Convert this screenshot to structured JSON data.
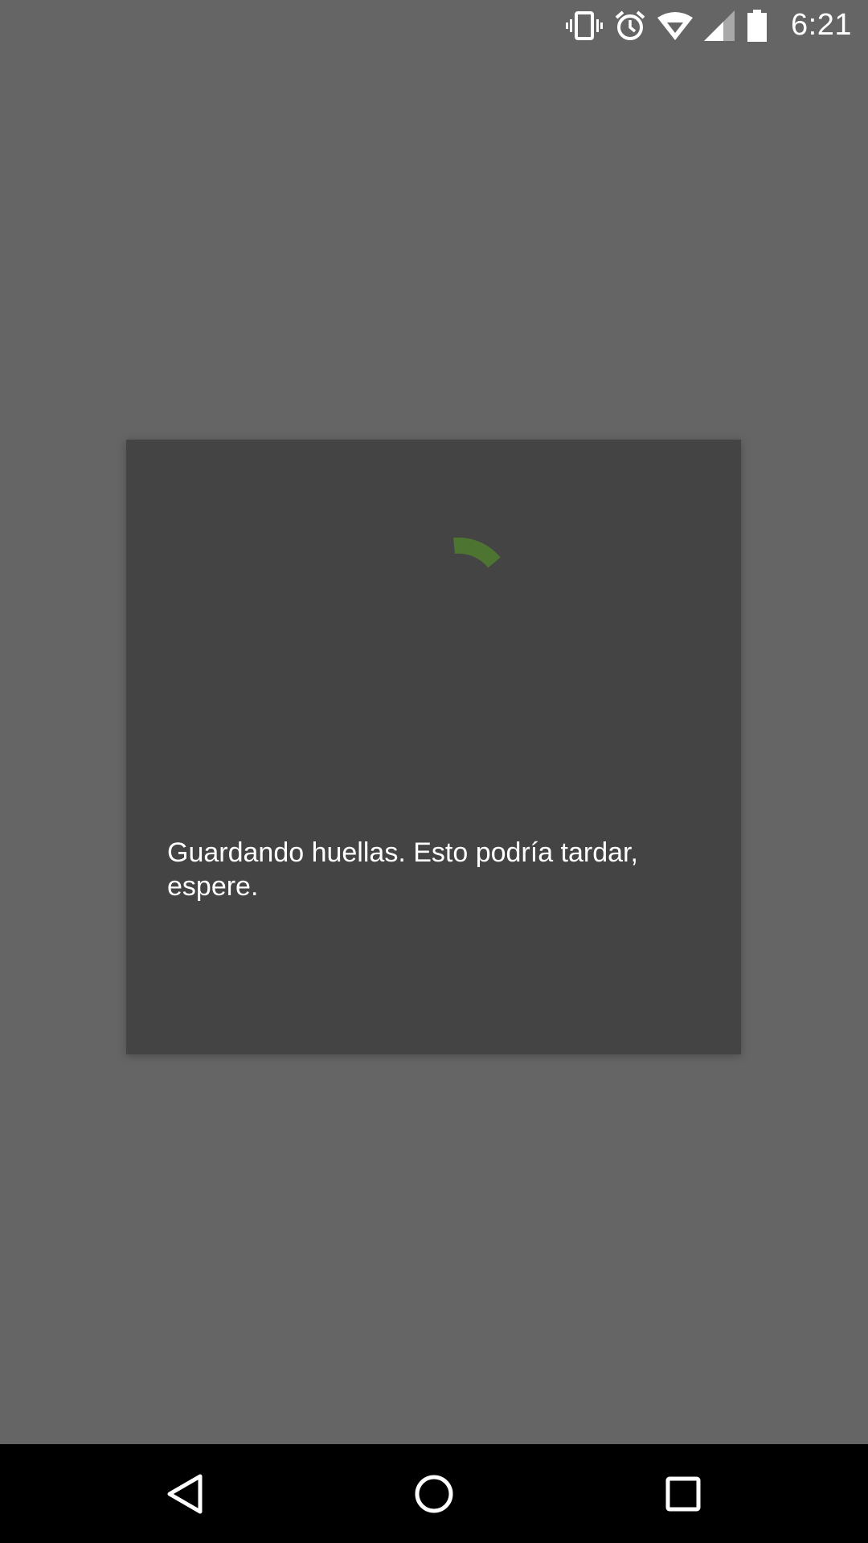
{
  "status_bar": {
    "time": "6:21",
    "icons": [
      "vibrate-icon",
      "alarm-icon",
      "wifi-icon",
      "signal-icon",
      "battery-icon"
    ]
  },
  "dialog": {
    "message": "Guardando huellas. Esto podría tardar, espere.",
    "spinner_color": "#4e7432"
  },
  "nav_bar": {
    "buttons": [
      "back-icon",
      "home-icon",
      "recents-icon"
    ]
  },
  "colors": {
    "background_scrim": "#656565",
    "dialog_background": "#444444",
    "nav_bar": "#000000",
    "accent": "#4e7432"
  }
}
